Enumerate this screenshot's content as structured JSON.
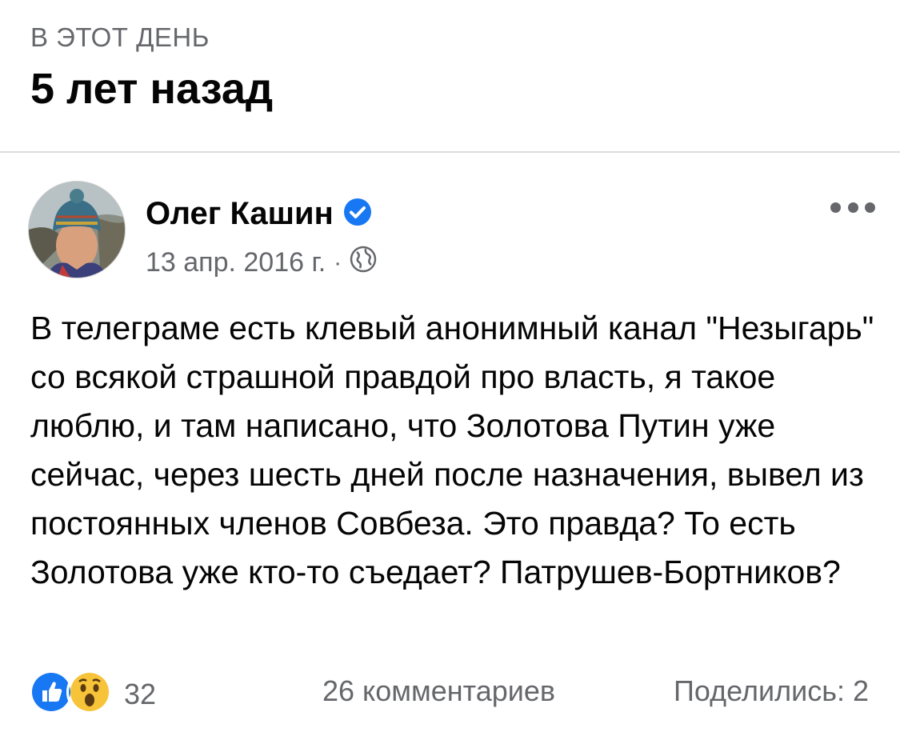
{
  "header": {
    "section_label": "В ЭТОТ ДЕНЬ",
    "title": "5 лет назад"
  },
  "post": {
    "author": "Олег Кашин",
    "date": "13 апр. 2016 г.",
    "separator": "·",
    "privacy_icon": "globe-icon",
    "verified_icon": "verified-badge-icon",
    "text": "В телеграме есть клевый анонимный канал \"Незыгарь\" со всякой страшной правдой про власть, я такое люблю, и там написано, что Золотова Путин уже сейчас, через шесть дней после назначения, вывел из постоянных членов Совбеза. Это правда? То есть Золотова уже кто-то съедает? Патрушев-Бортников?",
    "reactions": {
      "icons": [
        "like-icon",
        "wow-icon"
      ],
      "count": "32"
    },
    "comments": "26 комментариев",
    "shares": "Поделились: 2"
  },
  "colors": {
    "secondary_text": "#65676b",
    "accent_blue": "#1877f2",
    "divider": "#dadde1"
  }
}
